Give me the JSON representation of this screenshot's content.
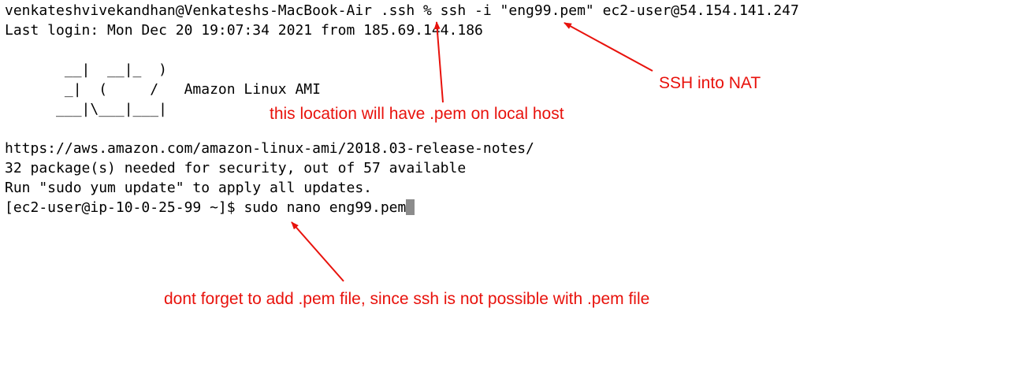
{
  "terminal": {
    "lines": [
      "venkateshvivekandhan@Venkateshs-MacBook-Air .ssh % ssh -i \"eng99.pem\" ec2-user@54.154.141.247",
      "Last login: Mon Dec 20 19:07:34 2021 from 185.69.144.186",
      "",
      "       __|  __|_  )",
      "       _|  (     /   Amazon Linux AMI",
      "      ___|\\___|___|",
      "",
      "https://aws.amazon.com/amazon-linux-ami/2018.03-release-notes/",
      "32 package(s) needed for security, out of 57 available",
      "Run \"sudo yum update\" to apply all updates."
    ],
    "prompt": "[ec2-user@ip-10-0-25-99 ~]$ ",
    "command": "sudo nano eng99.pem"
  },
  "annotations": {
    "ssh_into_nat": "SSH into NAT",
    "pem_location": "this location will have .pem on local host",
    "add_pem_file": "dont forget to add .pem file, since ssh is not possible with .pem file"
  },
  "colors": {
    "annotation": "#e8120c",
    "cursor": "#8c8c8c",
    "background": "#ffffff",
    "text": "#000000"
  }
}
